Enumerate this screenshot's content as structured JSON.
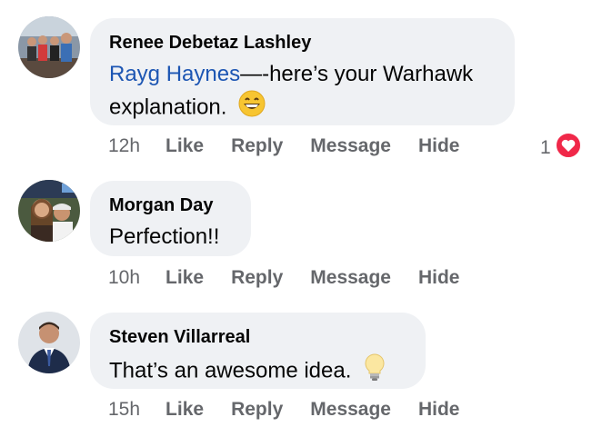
{
  "comments": [
    {
      "author": "Renee Debetaz Lashley",
      "mention": "Rayg Haynes",
      "text_after_mention": "—-here’s your Warhawk",
      "text_line2": "explanation.",
      "emoji": "grinning-face-icon",
      "time": "12h",
      "actions": [
        "Like",
        "Reply",
        "Message",
        "Hide"
      ],
      "reaction_count": "1",
      "reaction_icon": "heart-reaction-icon"
    },
    {
      "author": "Morgan Day",
      "text": "Perfection!!",
      "time": "10h",
      "actions": [
        "Like",
        "Reply",
        "Message",
        "Hide"
      ]
    },
    {
      "author": "Steven Villarreal",
      "text": "That’s an awesome idea.",
      "emoji": "lightbulb-icon",
      "time": "15h",
      "actions": [
        "Like",
        "Reply",
        "Message",
        "Hide"
      ]
    }
  ],
  "colors": {
    "bubble": "#eff1f4",
    "mention": "#1d56b3",
    "meta": "#65676b",
    "heart": "#f02849"
  }
}
